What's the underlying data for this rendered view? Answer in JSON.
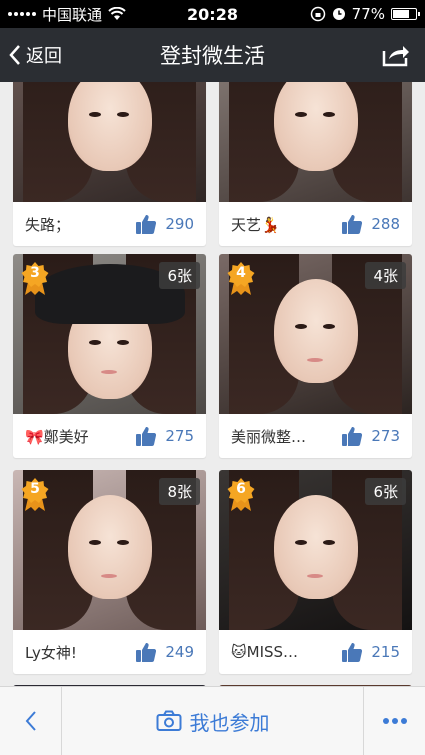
{
  "status_bar": {
    "carrier": "中国联通",
    "time": "20:28",
    "battery": "77%",
    "battery_level": 0.77
  },
  "nav": {
    "back_label": "返回",
    "title": "登封微生活"
  },
  "cards": [
    {
      "name": "失路；",
      "likes": "290",
      "rank": "",
      "photo_count": ""
    },
    {
      "name": "天艺💃",
      "likes": "288",
      "rank": "",
      "photo_count": ""
    },
    {
      "name": "🎀鄭美好",
      "likes": "275",
      "rank": "3",
      "photo_count": "6张"
    },
    {
      "name": "美丽微整…",
      "likes": "273",
      "rank": "4",
      "photo_count": "4张"
    },
    {
      "name": "Ly女神!",
      "likes": "249",
      "rank": "5",
      "photo_count": "8张"
    },
    {
      "name": "🐱MISS…",
      "likes": "215",
      "rank": "6",
      "photo_count": "6张"
    }
  ],
  "toolbar": {
    "join_label": "我也参加"
  },
  "colors": {
    "accent": "#3c7bd6",
    "like_color": "#4a78b8",
    "rank_badge": "#f5a623",
    "navbar": "#2b2e33"
  }
}
